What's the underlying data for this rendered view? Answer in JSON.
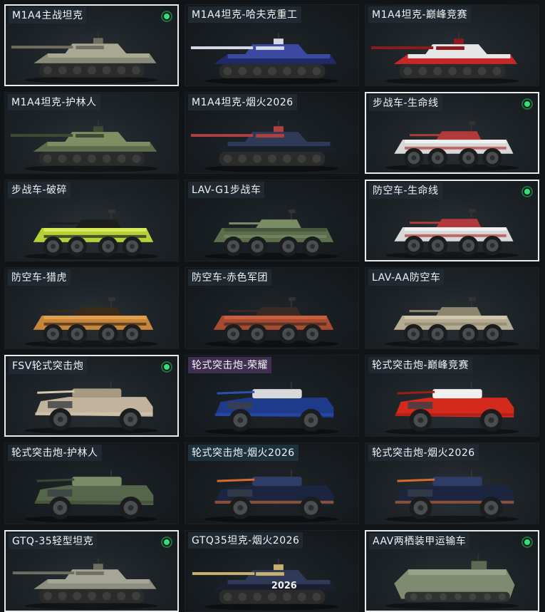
{
  "vehicles": [
    {
      "name": "M1A4主战坦克",
      "type": "tank",
      "equipped": true,
      "selected": true,
      "colors": [
        "#8a8a78",
        "#a9a893",
        "#6e6f60"
      ]
    },
    {
      "name": "M1A4坦克-哈夫克重工",
      "type": "tank",
      "equipped": false,
      "selected": false,
      "colors": [
        "#1f2a66",
        "#3b4aa0",
        "#d7d9e6"
      ]
    },
    {
      "name": "M1A4坦克-巅峰竞赛",
      "type": "tank",
      "equipped": false,
      "selected": false,
      "colors": [
        "#c62828",
        "#e6e6e6",
        "#8c1c1c"
      ]
    },
    {
      "name": "M1A4坦克-护林人",
      "type": "tank",
      "equipped": false,
      "selected": false,
      "colors": [
        "#5c6b4a",
        "#7f8e63",
        "#3f4a33"
      ]
    },
    {
      "name": "M1A4坦克-烟火2026",
      "type": "tank",
      "equipped": false,
      "selected": false,
      "colors": [
        "#1a1f2c",
        "#2f3a58",
        "#b04040"
      ]
    },
    {
      "name": "步战车-生命线",
      "type": "ifv",
      "equipped": true,
      "selected": true,
      "colors": [
        "#d8d8d8",
        "#b23a3a",
        "#f0f0f0"
      ]
    },
    {
      "name": "步战车-破碎",
      "type": "ifv",
      "equipped": false,
      "selected": false,
      "colors": [
        "#b6d03a",
        "#1e1e1e",
        "#d9ea5a"
      ]
    },
    {
      "name": "LAV-G1步战车",
      "type": "ifv",
      "equipped": false,
      "selected": false,
      "colors": [
        "#5c6e4c",
        "#7a8c66",
        "#49573c"
      ]
    },
    {
      "name": "防空车-生命线",
      "type": "ifv",
      "equipped": true,
      "selected": true,
      "colors": [
        "#d8d8d8",
        "#b23a3a",
        "#f0f0f0"
      ]
    },
    {
      "name": "防空车-猎虎",
      "type": "ifv",
      "equipped": false,
      "selected": false,
      "colors": [
        "#c7863a",
        "#3a2a1a",
        "#e0a050"
      ]
    },
    {
      "name": "防空车-赤色军团",
      "type": "ifv",
      "equipped": false,
      "selected": false,
      "colors": [
        "#a84a30",
        "#3b2a24",
        "#c86040"
      ]
    },
    {
      "name": "LAV-AA防空车",
      "type": "ifv",
      "equipped": false,
      "selected": false,
      "colors": [
        "#b4ab92",
        "#8d856e",
        "#cfc6ab"
      ]
    },
    {
      "name": "FSV轮式突击炮",
      "type": "apc",
      "equipped": true,
      "selected": true,
      "colors": [
        "#c2b49c",
        "#a89a82",
        "#d6cab2"
      ]
    },
    {
      "name": "轮式突击炮-荣耀",
      "type": "apc",
      "equipped": false,
      "selected": false,
      "colors": [
        "#1e3a8a",
        "#d9d9d9",
        "#2a4fb0"
      ],
      "tag": "purple"
    },
    {
      "name": "轮式突击炮-巅峰竞赛",
      "type": "apc",
      "equipped": false,
      "selected": false,
      "colors": [
        "#d42a1e",
        "#f0f0f0",
        "#a01c14"
      ]
    },
    {
      "name": "轮式突击炮-护林人",
      "type": "apc",
      "equipped": false,
      "selected": false,
      "colors": [
        "#55664a",
        "#7a8a66",
        "#3c4733"
      ]
    },
    {
      "name": "轮式突击炮-烟火2026",
      "type": "apc",
      "equipped": false,
      "selected": false,
      "colors": [
        "#1c2540",
        "#2f3d66",
        "#d86a30"
      ],
      "tag": "teal"
    },
    {
      "name": "轮式突击炮-烟火2026",
      "type": "apc",
      "equipped": false,
      "selected": false,
      "colors": [
        "#1c2540",
        "#2f3d66",
        "#d86a30"
      ]
    },
    {
      "name": "GTQ-35轻型坦克",
      "type": "light",
      "equipped": true,
      "selected": true,
      "colors": [
        "#8e8e80",
        "#a6a696",
        "#6e6e62"
      ]
    },
    {
      "name": "GTQ35坦克-烟火2026",
      "type": "light",
      "equipped": false,
      "selected": false,
      "colors": [
        "#1a2030",
        "#2e3a56",
        "#c8b070"
      ],
      "text": "2026"
    },
    {
      "name": "AAV两栖装甲运输车",
      "type": "aav",
      "equipped": true,
      "selected": true,
      "colors": [
        "#7f8a70",
        "#98a387",
        "#5f6a54"
      ]
    }
  ],
  "icons": {
    "equipped": "green-dot-icon"
  }
}
